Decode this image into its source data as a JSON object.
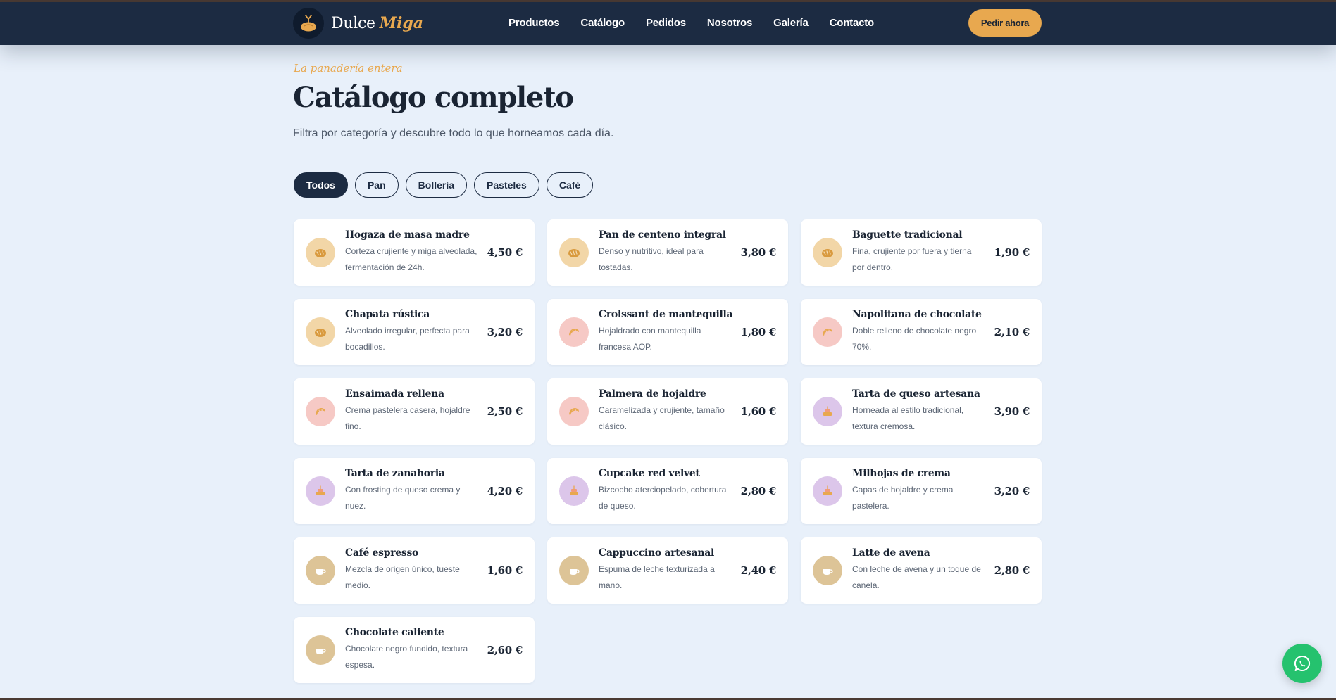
{
  "brand": {
    "name": "Dulce",
    "accent": "Miga",
    "logo_icon": "bread-logo-icon"
  },
  "nav": [
    "Productos",
    "Catálogo",
    "Pedidos",
    "Nosotros",
    "Galería",
    "Contacto"
  ],
  "cta": "Pedir ahora",
  "hero": {
    "eyebrow": "La panadería entera",
    "title": "Catálogo completo",
    "subtitle": "Filtra por categoría y descubre todo lo que horneamos cada día."
  },
  "filters": {
    "items": [
      "Todos",
      "Pan",
      "Bollería",
      "Pasteles",
      "Café"
    ],
    "active": "Todos"
  },
  "category_styles": {
    "pan": {
      "icon": "bread-icon",
      "color": "#f2d6a7"
    },
    "bolleria": {
      "icon": "croissant-icon",
      "color": "#f6c9c5"
    },
    "pasteles": {
      "icon": "cake-icon",
      "color": "#dcc6ea"
    },
    "cafe": {
      "icon": "coffee-cup-icon",
      "color": "#ddc497"
    }
  },
  "products": [
    {
      "name": "Hogaza de masa madre",
      "description": "Corteza crujiente y miga alveolada, fermentación de 24h.",
      "price": "4,50 €",
      "category": "pan"
    },
    {
      "name": "Pan de centeno integral",
      "description": "Denso y nutritivo, ideal para tostadas.",
      "price": "3,80 €",
      "category": "pan"
    },
    {
      "name": "Baguette tradicional",
      "description": "Fina, crujiente por fuera y tierna por dentro.",
      "price": "1,90 €",
      "category": "pan"
    },
    {
      "name": "Chapata rústica",
      "description": "Alveolado irregular, perfecta para bocadillos.",
      "price": "3,20 €",
      "category": "pan"
    },
    {
      "name": "Croissant de mantequilla",
      "description": "Hojaldrado con mantequilla francesa AOP.",
      "price": "1,80 €",
      "category": "bolleria"
    },
    {
      "name": "Napolitana de chocolate",
      "description": "Doble relleno de chocolate negro 70%.",
      "price": "2,10 €",
      "category": "bolleria"
    },
    {
      "name": "Ensaimada rellena",
      "description": "Crema pastelera casera, hojaldre fino.",
      "price": "2,50 €",
      "category": "bolleria"
    },
    {
      "name": "Palmera de hojaldre",
      "description": "Caramelizada y crujiente, tamaño clásico.",
      "price": "1,60 €",
      "category": "bolleria"
    },
    {
      "name": "Tarta de queso artesana",
      "description": "Horneada al estilo tradicional, textura cremosa.",
      "price": "3,90 €",
      "category": "pasteles"
    },
    {
      "name": "Tarta de zanahoria",
      "description": "Con frosting de queso crema y nuez.",
      "price": "4,20 €",
      "category": "pasteles"
    },
    {
      "name": "Cupcake red velvet",
      "description": "Bizcocho aterciopelado, cobertura de queso.",
      "price": "2,80 €",
      "category": "pasteles"
    },
    {
      "name": "Milhojas de crema",
      "description": "Capas de hojaldre y crema pastelera.",
      "price": "3,20 €",
      "category": "pasteles"
    },
    {
      "name": "Café espresso",
      "description": "Mezcla de origen único, tueste medio.",
      "price": "1,60 €",
      "category": "cafe"
    },
    {
      "name": "Cappuccino artesanal",
      "description": "Espuma de leche texturizada a mano.",
      "price": "2,40 €",
      "category": "cafe"
    },
    {
      "name": "Latte de avena",
      "description": "Con leche de avena y un toque de canela.",
      "price": "2,80 €",
      "category": "cafe"
    },
    {
      "name": "Chocolate caliente",
      "description": "Chocolate negro fundido, textura espesa.",
      "price": "2,60 €",
      "category": "cafe"
    }
  ],
  "whatsapp": {
    "icon": "whatsapp-icon",
    "color": "#25c26e"
  },
  "colors": {
    "navy": "#1c2b42",
    "accent": "#e8a84f",
    "background": "#e8f0fa"
  }
}
